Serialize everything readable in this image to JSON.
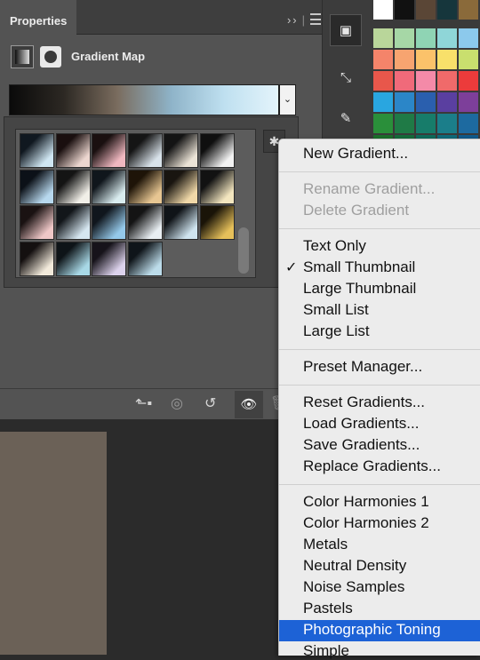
{
  "panel": {
    "tab_label": "Properties",
    "expand_glyph": "››",
    "divider_glyph": "|",
    "adjustment_title": "Gradient Map",
    "gradient_colors": [
      "#0a0a0a",
      "#2c2823",
      "#7a6c5e",
      "#8eb3c8",
      "#bfe0f0",
      "#e4f4fb"
    ],
    "dropdown_glyph": "⌄",
    "gear_glyph": "✱"
  },
  "gradient_presets": [
    {
      "a": "#101820",
      "b": "#cfe6f2"
    },
    {
      "a": "#1a0f0f",
      "b": "#ecd6cf"
    },
    {
      "a": "#1a1010",
      "b": "#f0b8c0"
    },
    {
      "a": "#151515",
      "b": "#d8e2ea"
    },
    {
      "a": "#141414",
      "b": "#ebe3d6"
    },
    {
      "a": "#0f0f0f",
      "b": "#f2f2f2"
    },
    {
      "a": "#0c1118",
      "b": "#b7d8ee"
    },
    {
      "a": "#141414",
      "b": "#f1efe8"
    },
    {
      "a": "#10161c",
      "b": "#d9ecef"
    },
    {
      "a": "#1e1408",
      "b": "#e7c692"
    },
    {
      "a": "#191510",
      "b": "#f0d8a8"
    },
    {
      "a": "#121212",
      "b": "#f3e6bf"
    },
    {
      "a": "#1a1212",
      "b": "#efc7c7"
    },
    {
      "a": "#12161a",
      "b": "#d5e6f0"
    },
    {
      "a": "#10161d",
      "b": "#95c9ea"
    },
    {
      "a": "#141414",
      "b": "#e8eef2"
    },
    {
      "a": "#101418",
      "b": "#cfe4ef"
    },
    {
      "a": "#1a1408",
      "b": "#e6c05a"
    },
    {
      "a": "#141010",
      "b": "#f2eadb"
    },
    {
      "a": "#0e1418",
      "b": "#a8d8e6"
    },
    {
      "a": "#16131a",
      "b": "#dcd2ec"
    },
    {
      "a": "#0f151a",
      "b": "#bcdcea"
    }
  ],
  "bottom_bar": {
    "clip_glyph": "⬑▪",
    "view_prev_glyph": "◎",
    "reset_glyph": "↺",
    "visibility_glyph": "👁",
    "trash_glyph": "🗑"
  },
  "tool_strip": {
    "properties_glyph": "▣",
    "transform_glyph": "⤡",
    "brush_glyph": "✎"
  },
  "color_swatches": [
    [
      "#ffffff",
      "#111111",
      "#5a4636",
      "#16363c",
      "#8a6a3a",
      "#b58a44"
    ],
    [
      "#b9d69a",
      "#a6d7a6",
      "#8fd4b4",
      "#8fd6d8",
      "#8cc9ec",
      "#a3bfe4"
    ],
    [
      "#f4846a",
      "#f7a470",
      "#fbc26a",
      "#f8e06a",
      "#c9df6e",
      "#8fd07a"
    ],
    [
      "#e8574b",
      "#f06a7a",
      "#f48aa8",
      "#f06a6a",
      "#ec3b3b",
      "#e25a2c"
    ],
    [
      "#29a6e0",
      "#2b86c8",
      "#2a5fae",
      "#5a3fa0",
      "#7d3f9a",
      "#a63f96"
    ],
    [
      "#2a8f3a",
      "#1f7a46",
      "#177c6a",
      "#1b7e8a",
      "#1d6aa0",
      "#2b4d90"
    ],
    [
      "#1b6e2a",
      "#156a3a",
      "#0e6a5a",
      "#0f6a7a",
      "#105a8c",
      "#1c3e80"
    ]
  ],
  "menu": {
    "items": [
      "New Gradient...",
      "Rename Gradient...",
      "Delete Gradient",
      "Text Only",
      "Small Thumbnail",
      "Large Thumbnail",
      "Small List",
      "Large List",
      "Preset Manager...",
      "Reset Gradients...",
      "Load Gradients...",
      "Save Gradients...",
      "Replace Gradients...",
      "Color Harmonies 1",
      "Color Harmonies 2",
      "Metals",
      "Neutral Density",
      "Noise Samples",
      "Pastels",
      "Photographic Toning",
      "Simple"
    ],
    "checked_item": "Small Thumbnail",
    "checkmark": "✓",
    "highlighted_item": "Photographic Toning",
    "highlight_color": "#1d62d6"
  }
}
